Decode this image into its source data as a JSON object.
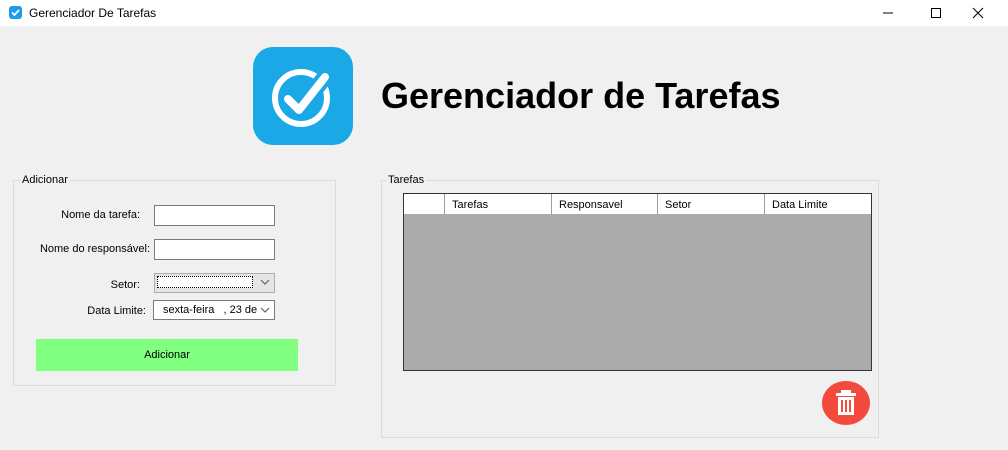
{
  "window": {
    "title": "Gerenciador De Tarefas"
  },
  "header": {
    "logo_icon": "check-circle-icon",
    "title": "Gerenciador de Tarefas"
  },
  "form": {
    "legend": "Adicionar",
    "nome_tarefa_label": "Nome da tarefa:",
    "nome_tarefa_value": "",
    "responsavel_label": "Nome do responsável:",
    "responsavel_value": "",
    "setor_label": "Setor:",
    "setor_value": "",
    "data_label": "Data Limite:",
    "data_value": "sexta-feira   , 23 de",
    "add_button": "Adicionar"
  },
  "tasks": {
    "legend": "Tarefas",
    "columns": [
      "Tarefas",
      "Responsavel",
      "Setor",
      "Data Limite"
    ],
    "rows": []
  },
  "colors": {
    "add_button": "#80ff80",
    "delete_button": "#f24a3c",
    "logo": "#1ba8e6",
    "grid_background": "#ababab"
  }
}
